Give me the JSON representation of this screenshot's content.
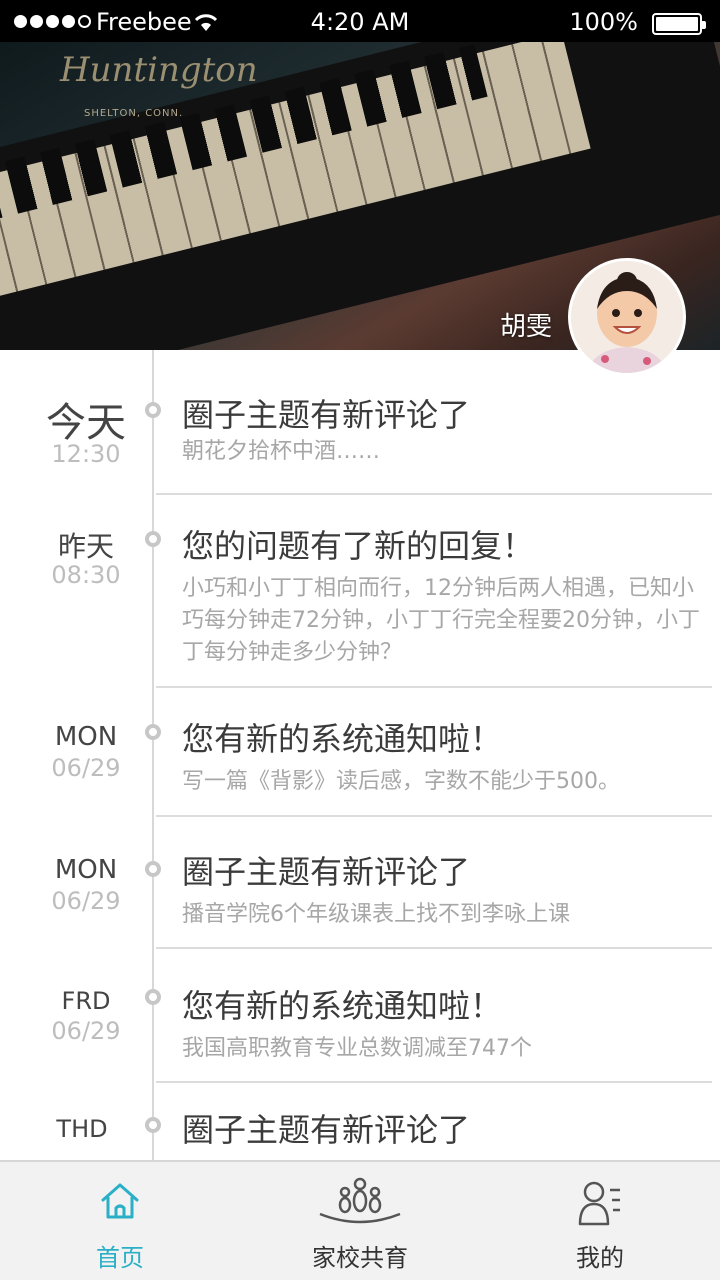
{
  "status_bar": {
    "carrier": "Freebee",
    "time": "4:20 AM",
    "battery": "100%",
    "signal_level": 4,
    "battery_level": 1.0
  },
  "header": {
    "brand_script": "Huntington",
    "brand_sub": "SHELTON, CONN.",
    "profile_name": "胡雯"
  },
  "timeline": [
    {
      "date_main": "今天",
      "date_sub": "12:30",
      "title": "圈子主题有新评论了",
      "desc": "朝花夕拾杯中酒……"
    },
    {
      "date_main": "昨天",
      "date_sub": "08:30",
      "title": "您的问题有了新的回复！",
      "desc": "小巧和小丁丁相向而行，12分钟后两人相遇，已知小巧每分钟走72分钟，小丁丁行完全程要20分钟，小丁丁每分钟走多少分钟？"
    },
    {
      "date_main": "MON",
      "date_sub": "06/29",
      "title": "您有新的系统通知啦！",
      "desc": "写一篇《背影》读后感，字数不能少于500。"
    },
    {
      "date_main": "MON",
      "date_sub": "06/29",
      "title": "圈子主题有新评论了",
      "desc": "播音学院6个年级课表上找不到李咏上课"
    },
    {
      "date_main": "FRD",
      "date_sub": "06/29",
      "title": "您有新的系统通知啦！",
      "desc": "我国高职教育专业总数调减至747个"
    },
    {
      "date_main": "THD",
      "date_sub": "",
      "title": "圈子主题有新评论了",
      "desc": ""
    }
  ],
  "tabs": [
    {
      "label": "首页",
      "icon": "home-icon",
      "active": true
    },
    {
      "label": "家校共育",
      "icon": "family-icon",
      "active": false
    },
    {
      "label": "我的",
      "icon": "profile-icon",
      "active": false
    }
  ],
  "colors": {
    "accent": "#2ab0c6",
    "text": "#3b3b3b",
    "muted": "#a7a7a7"
  }
}
